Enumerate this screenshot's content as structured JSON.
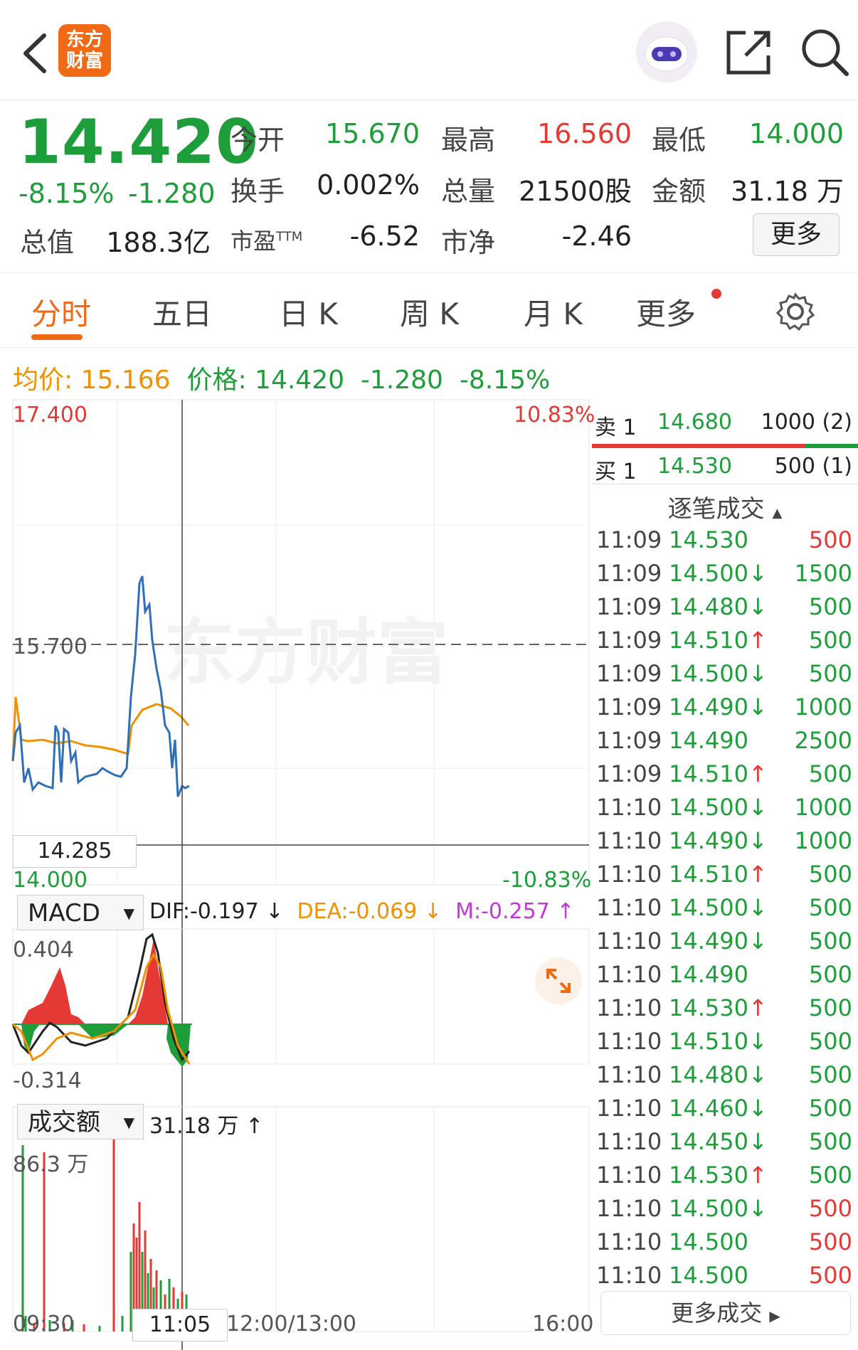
{
  "app": {
    "logo_line1": "东方",
    "logo_line2": "财富"
  },
  "quote": {
    "price": "14.420",
    "change_pct": "-8.15%",
    "change_abs": "-1.280",
    "open_label": "今开",
    "open": "15.670",
    "high_label": "最高",
    "high": "16.560",
    "low_label": "最低",
    "low": "14.000",
    "turnover_label": "换手",
    "turnover": "0.002%",
    "volume_label": "总量",
    "volume": "21500股",
    "amount_label": "金额",
    "amount": "31.18 万",
    "mktcap_label": "总值",
    "mktcap": "188.3亿",
    "pe_label": "市盈",
    "pe_sup": "TTM",
    "pe": "-6.52",
    "pb_label": "市净",
    "pb": "-2.46",
    "more_label": "更多"
  },
  "tabs": [
    "分时",
    "五日",
    "日 K",
    "周 K",
    "月 K",
    "更多"
  ],
  "info_row": {
    "avg_label": "均价:",
    "avg": "15.166",
    "price_label": "价格:",
    "price": "14.420",
    "chg": "-1.280",
    "pct": "-8.15%"
  },
  "chart": {
    "y_top": "17.400",
    "y_top_pct": "10.83%",
    "y_bottom": "14.000",
    "y_bottom_pct": "-10.83%",
    "prev_close": "15.700",
    "cursor_price": "14.285",
    "x_labels": [
      "09:30",
      "11:05",
      "12:00/13:00",
      "16:00"
    ],
    "watermark": "东方财富"
  },
  "macd": {
    "selector": "MACD",
    "dif": "DIF:-0.197 ↓",
    "dea": "DEA:-0.069 ↓",
    "m": "M:-0.257 ↑",
    "y_top": "0.404",
    "y_bottom": "-0.314"
  },
  "volume": {
    "selector": "成交额",
    "value": "31.18 万 ↑",
    "y_top": "86.3 万"
  },
  "order_book": {
    "sell_label": "卖 1",
    "sell_price": "14.680",
    "sell_qty": "1000 (2)",
    "buy_label": "买 1",
    "buy_price": "14.530",
    "buy_qty": "500  (1)",
    "ticks_title": "逐笔成交",
    "more_trades": "更多成交"
  },
  "ticks": [
    {
      "time": "11:09",
      "price": "14.530",
      "dir": "",
      "qty": "500",
      "qcolor": "red"
    },
    {
      "time": "11:09",
      "price": "14.500",
      "dir": "↓",
      "qty": "1500",
      "qcolor": "green"
    },
    {
      "time": "11:09",
      "price": "14.480",
      "dir": "↓",
      "qty": "500",
      "qcolor": "green"
    },
    {
      "time": "11:09",
      "price": "14.510",
      "dir": "↑",
      "qty": "500",
      "qcolor": "green"
    },
    {
      "time": "11:09",
      "price": "14.500",
      "dir": "↓",
      "qty": "500",
      "qcolor": "green"
    },
    {
      "time": "11:09",
      "price": "14.490",
      "dir": "↓",
      "qty": "1000",
      "qcolor": "green"
    },
    {
      "time": "11:09",
      "price": "14.490",
      "dir": "",
      "qty": "2500",
      "qcolor": "green"
    },
    {
      "time": "11:09",
      "price": "14.510",
      "dir": "↑",
      "qty": "500",
      "qcolor": "green"
    },
    {
      "time": "11:10",
      "price": "14.500",
      "dir": "↓",
      "qty": "1000",
      "qcolor": "green"
    },
    {
      "time": "11:10",
      "price": "14.490",
      "dir": "↓",
      "qty": "1000",
      "qcolor": "green"
    },
    {
      "time": "11:10",
      "price": "14.510",
      "dir": "↑",
      "qty": "500",
      "qcolor": "green"
    },
    {
      "time": "11:10",
      "price": "14.500",
      "dir": "↓",
      "qty": "500",
      "qcolor": "green"
    },
    {
      "time": "11:10",
      "price": "14.490",
      "dir": "↓",
      "qty": "500",
      "qcolor": "green"
    },
    {
      "time": "11:10",
      "price": "14.490",
      "dir": "",
      "qty": "500",
      "qcolor": "green"
    },
    {
      "time": "11:10",
      "price": "14.530",
      "dir": "↑",
      "qty": "500",
      "qcolor": "green"
    },
    {
      "time": "11:10",
      "price": "14.510",
      "dir": "↓",
      "qty": "500",
      "qcolor": "green"
    },
    {
      "time": "11:10",
      "price": "14.480",
      "dir": "↓",
      "qty": "500",
      "qcolor": "green"
    },
    {
      "time": "11:10",
      "price": "14.460",
      "dir": "↓",
      "qty": "500",
      "qcolor": "green"
    },
    {
      "time": "11:10",
      "price": "14.450",
      "dir": "↓",
      "qty": "500",
      "qcolor": "green"
    },
    {
      "time": "11:10",
      "price": "14.530",
      "dir": "↑",
      "qty": "500",
      "qcolor": "green"
    },
    {
      "time": "11:10",
      "price": "14.500",
      "dir": "↓",
      "qty": "500",
      "qcolor": "red"
    },
    {
      "time": "11:10",
      "price": "14.500",
      "dir": "",
      "qty": "500",
      "qcolor": "red"
    },
    {
      "time": "11:10",
      "price": "14.500",
      "dir": "",
      "qty": "500",
      "qcolor": "red"
    }
  ],
  "colors": {
    "up": "#e53935",
    "down": "#1e9e3a",
    "accent": "#f06a16",
    "avg_line": "#f29100",
    "price_line": "#2f6fb7"
  }
}
